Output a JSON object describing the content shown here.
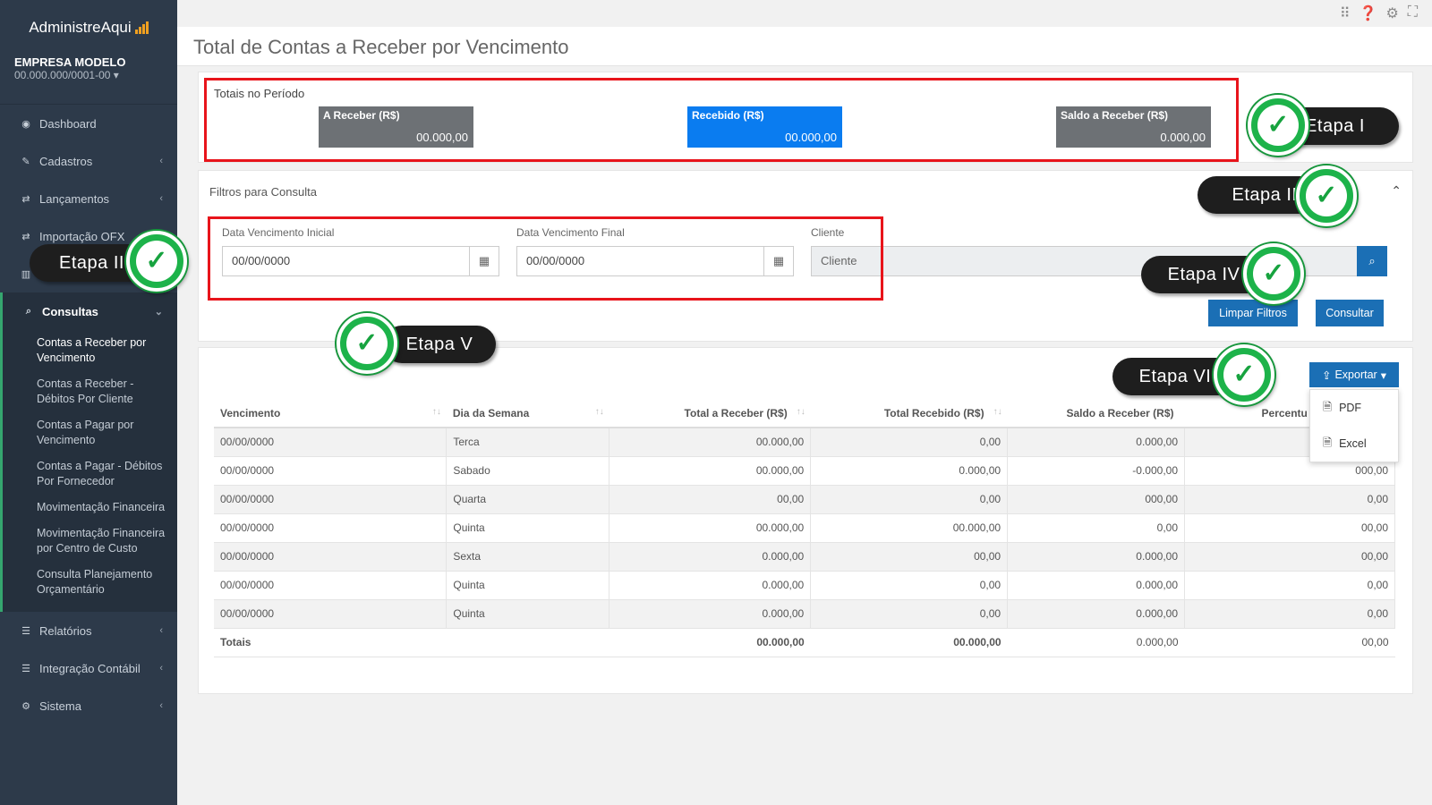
{
  "app": {
    "brand": "AdministreAqui"
  },
  "company": {
    "name": "EMPRESA MODELO",
    "cnpj": "00.000.000/0001-00"
  },
  "sidebar": {
    "items": [
      {
        "label": "Dashboard"
      },
      {
        "label": "Cadastros"
      },
      {
        "label": "Lançamentos"
      },
      {
        "label": "Importação OFX"
      }
    ],
    "consultas": {
      "label": "Consultas",
      "children": [
        {
          "label": "Contas a Receber por Vencimento"
        },
        {
          "label": "Contas a Receber - Débitos Por Cliente"
        },
        {
          "label": "Contas a Pagar por Vencimento"
        },
        {
          "label": "Contas a Pagar - Débitos Por Fornecedor"
        },
        {
          "label": "Movimentação Financeira"
        },
        {
          "label": "Movimentação Financeira por Centro de Custo"
        },
        {
          "label": "Consulta Planejamento Orçamentário"
        }
      ]
    },
    "bottom": [
      {
        "label": "Relatórios"
      },
      {
        "label": "Integração Contábil"
      },
      {
        "label": "Sistema"
      }
    ]
  },
  "page": {
    "title": "Total de Contas a Receber por Vencimento"
  },
  "totals": {
    "title": "Totais no Período",
    "a_receber": {
      "label": "A Receber (R$)",
      "value": "00.000,00"
    },
    "recebido": {
      "label": "Recebido (R$)",
      "value": "00.000,00"
    },
    "saldo": {
      "label": "Saldo a Receber (R$)",
      "value": "0.000,00"
    }
  },
  "filters": {
    "title": "Filtros para Consulta",
    "data_inicial": {
      "label": "Data Vencimento Inicial",
      "value": "00/00/0000"
    },
    "data_final": {
      "label": "Data Vencimento Final",
      "value": "00/00/0000"
    },
    "cliente": {
      "label": "Cliente",
      "placeholder": "Cliente"
    },
    "limpar": "Limpar Filtros",
    "consultar": "Consultar"
  },
  "export": {
    "label": "Exportar",
    "options": [
      "PDF",
      "Excel"
    ]
  },
  "table": {
    "headers": [
      "Vencimento",
      "Dia da Semana",
      "Total a Receber (R$)",
      "Total Recebido (R$)",
      "Saldo a Receber (R$)",
      "Percentu"
    ],
    "rows": [
      [
        "00/00/0000",
        "Terca",
        "00.000,00",
        "0,00",
        "0.000,00",
        ""
      ],
      [
        "00/00/0000",
        "Sabado",
        "00.000,00",
        "0.000,00",
        "-0.000,00",
        "000,00"
      ],
      [
        "00/00/0000",
        "Quarta",
        "00,00",
        "0,00",
        "000,00",
        "0,00"
      ],
      [
        "00/00/0000",
        "Quinta",
        "00.000,00",
        "00.000,00",
        "0,00",
        "00,00"
      ],
      [
        "00/00/0000",
        "Sexta",
        "0.000,00",
        "00,00",
        "0.000,00",
        "00,00"
      ],
      [
        "00/00/0000",
        "Quinta",
        "0.000,00",
        "0,00",
        "0.000,00",
        "0,00"
      ],
      [
        "00/00/0000",
        "Quinta",
        "0.000,00",
        "0,00",
        "0.000,00",
        "0,00"
      ]
    ],
    "footer": [
      "Totais",
      "",
      "00.000,00",
      "00.000,00",
      "0.000,00",
      "00,00"
    ]
  },
  "annotations": {
    "etapa1": "Etapa I",
    "etapa2": "Etapa II",
    "etapa3": "Etapa III",
    "etapa4": "Etapa IV",
    "etapa5": "Etapa V",
    "etapa6": "Etapa VI"
  },
  "colors": {
    "sidebar": "#2d3a4a",
    "primary": "#1b6fb5",
    "highlight_blue": "#0a7cf0",
    "annotation_red": "#e8141b",
    "annotation_green": "#1db34a"
  }
}
